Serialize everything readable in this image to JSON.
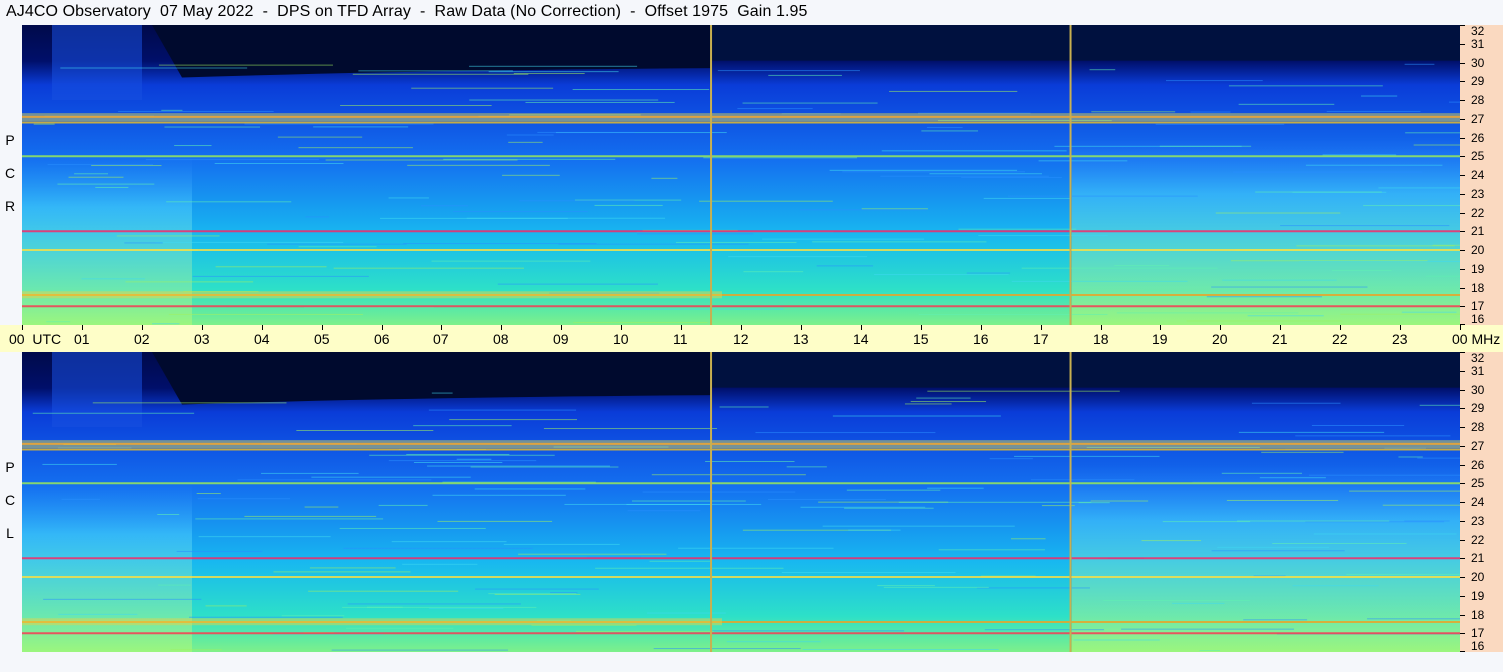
{
  "title": "AJ4CO Observatory  07 May 2022  -  DPS on TFD Array  -  Raw Data (No Correction)  -  Offset 1975  Gain 1.95",
  "colors": {
    "background": "#f5f7fb",
    "time_axis_bg": "#fefec8",
    "freq_axis_bg": "#fad9c0",
    "marker_line": "#c8b050"
  },
  "panels": {
    "rcp": {
      "label_letters": [
        "R",
        "C",
        "P"
      ]
    },
    "lcp": {
      "label_letters": [
        "L",
        "C",
        "P"
      ]
    }
  },
  "time_axis": {
    "labels": [
      "00  UTC",
      "01",
      "02",
      "03",
      "04",
      "05",
      "06",
      "07",
      "08",
      "09",
      "10",
      "11",
      "12",
      "13",
      "14",
      "15",
      "16",
      "17",
      "18",
      "19",
      "20",
      "21",
      "22",
      "23",
      "00 MHz"
    ]
  },
  "chart_data": {
    "type": "heatmap",
    "title": "AJ4CO Observatory  07 May 2022  -  DPS on TFD Array  -  Raw Data (No Correction)  -  Offset 1975  Gain 1.95",
    "xlabel": "UTC",
    "ylabel": "MHz",
    "x_range_hours": [
      0,
      24
    ],
    "y_range_mhz": [
      16,
      32
    ],
    "x_ticks": [
      "00",
      "01",
      "02",
      "03",
      "04",
      "05",
      "06",
      "07",
      "08",
      "09",
      "10",
      "11",
      "12",
      "13",
      "14",
      "15",
      "16",
      "17",
      "18",
      "19",
      "20",
      "21",
      "22",
      "23",
      "00"
    ],
    "y_ticks": [
      16,
      17,
      18,
      19,
      20,
      21,
      22,
      23,
      24,
      25,
      26,
      27,
      28,
      29,
      30,
      31,
      32
    ],
    "panels": [
      "RCP",
      "LCP"
    ],
    "marker_lines_hours": [
      11.5,
      17.5
    ],
    "intense_bands_mhz": [
      27.1,
      26.8,
      25.0,
      21.0,
      20.0,
      17.6,
      17.0
    ],
    "colormap": "jet (dark blue low, cyan mid, yellow/red high)"
  }
}
